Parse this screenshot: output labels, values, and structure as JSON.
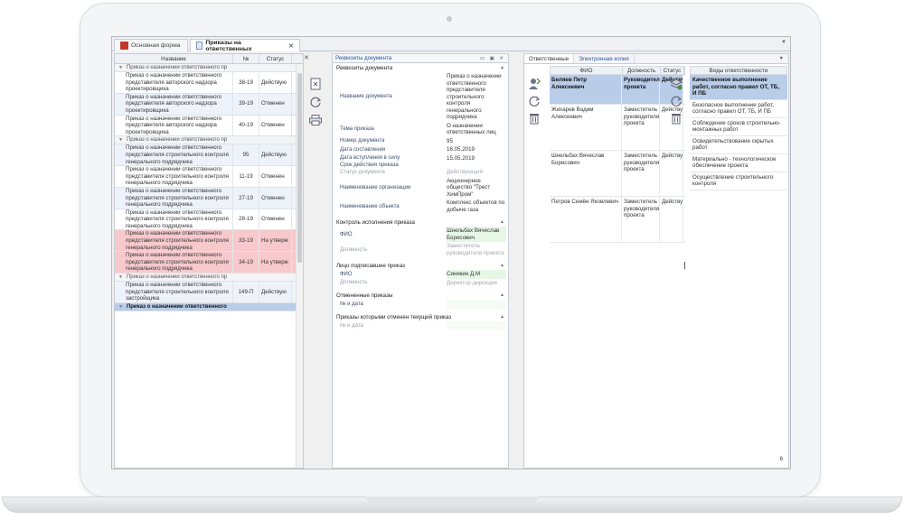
{
  "tabs": [
    {
      "label": "Основная форма"
    },
    {
      "label": "Приказы на ответственных"
    }
  ],
  "orders": {
    "columns": [
      "Название",
      "№",
      "Статус"
    ],
    "groups": [
      {
        "label": "Приказ о назначении ответственного пр",
        "rows": [
          {
            "name": "Приказ о назначении ответственного представителя авторского надзора проектировщика",
            "num": "38-19",
            "status": "Действую",
            "tone": "normal"
          },
          {
            "name": "Приказ о назначении ответственного представителя авторского надзора проектировщика",
            "num": "39-19",
            "status": "Отменен",
            "tone": "alt"
          },
          {
            "name": "Приказ о назначении ответственного представителя авторского надзора проектировщика",
            "num": "40-19",
            "status": "Отменен",
            "tone": "normal"
          }
        ]
      },
      {
        "label": "Приказ о назначении ответственного пр",
        "rows": [
          {
            "name": "Приказ о назначении ответственного представителя строительного контроля генерального подрядчика",
            "num": "95",
            "status": "Действую",
            "tone": "alt"
          },
          {
            "name": "Приказ о назначении ответственного представителя строительного контроля генерального подрядчика",
            "num": "11-19",
            "status": "Отменен",
            "tone": "normal"
          },
          {
            "name": "Приказ о назначении ответственного представителя строительного контроля генерального подрядчика",
            "num": "27-19",
            "status": "Отменен",
            "tone": "alt"
          },
          {
            "name": "Приказ о назначении ответственного представителя строительного контроля генерального подрядчика",
            "num": "28-19",
            "status": "Отменен",
            "tone": "normal"
          },
          {
            "name": "Приказ о назначении ответственного представителя строительного контроля генерального подрядчика",
            "num": "33-19",
            "status": "На утверж",
            "tone": "red"
          },
          {
            "name": "Приказ о назначении ответственного представителя строительного контроля генерального подрядчика",
            "num": "34-19",
            "status": "На утверж",
            "tone": "red"
          }
        ]
      },
      {
        "label": "Приказ о назначении ответственного пр",
        "rows": [
          {
            "name": "Приказ о назначении ответственного представителя строительного контроля застройщика",
            "num": "149-П",
            "status": "Действую",
            "tone": "alt"
          }
        ]
      }
    ],
    "selected_group": "Приказ о назначении ответственного"
  },
  "details": {
    "title": "Реквизиты документа",
    "sections": [
      {
        "title": "Реквизиты документа",
        "fields": [
          {
            "label": "Название документа",
            "value": "Приказ о назначении ответственного представителя строительного контроля генерального подрядчика",
            "dim": false,
            "style": ""
          },
          {
            "label": "Тема приказа",
            "value": "О назначении ответственных лиц",
            "dim": false,
            "style": ""
          },
          {
            "label": "Номер документа",
            "value": "95",
            "dim": false,
            "style": ""
          },
          {
            "label": "Дата составления",
            "value": "16.05.2019",
            "dim": false,
            "style": ""
          },
          {
            "label": "Дата вступления в силу",
            "value": "15.05.2019",
            "dim": false,
            "style": ""
          },
          {
            "label": "Срок действия приказа",
            "value": "",
            "dim": false,
            "style": ""
          },
          {
            "label": "Статус документа",
            "value": "Действующий",
            "dim": true,
            "style": ""
          },
          {
            "label": "Наименование организации",
            "value": "Акционерное общество \"Трест ХимПром\"",
            "dim": false,
            "style": ""
          },
          {
            "label": "Наименование объекта",
            "value": "Комплекс объектов по добыче газа",
            "dim": false,
            "style": ""
          }
        ]
      },
      {
        "title": "Контроль исполнения приказа",
        "fields": [
          {
            "label": "ФИО",
            "value": "Шнельбах Вячеслав Борисович",
            "dim": false,
            "style": "green"
          },
          {
            "label": "Должность",
            "value": "Заместитель руководителя проекта",
            "dim": true,
            "style": ""
          }
        ]
      },
      {
        "title": "Лицо подписавшее приказ",
        "fields": [
          {
            "label": "ФИО",
            "value": "Синякин Д.М",
            "dim": false,
            "style": "green"
          },
          {
            "label": "Должность",
            "value": "Директор дирекции",
            "dim": true,
            "style": ""
          }
        ]
      },
      {
        "title": "Отмененные приказы",
        "fields": [
          {
            "label": "№ и дата",
            "value": "",
            "dim": false,
            "style": "empty"
          }
        ]
      },
      {
        "title": "Приказы которыми отменен текущий приказ",
        "fields": [
          {
            "label": "№ и дата",
            "value": "",
            "dim": true,
            "style": "empty"
          }
        ]
      }
    ]
  },
  "responsible": {
    "tabs": [
      "Ответственные",
      "Электронная копия"
    ],
    "columns": [
      "ФИО",
      "Должность",
      "Статус"
    ],
    "types_column": "Виды ответственности",
    "people": [
      {
        "fio": "Беляев Петр Алексеевич",
        "position": "Руководитель проекта",
        "status": "Действую",
        "selected": true
      },
      {
        "fio": "Жихарев Вадим Алексеевич",
        "position": "Заместитель руководителя проекта",
        "status": "Действую",
        "selected": false
      },
      {
        "fio": "Шнельбах Вячеслав Борисович",
        "position": "Заместитель руководителя проекта",
        "status": "Действую",
        "selected": false
      },
      {
        "fio": "Петров Семён Яковлевич",
        "position": "Заместитель руководителя проекта",
        "status": "Действую",
        "selected": false
      }
    ],
    "types": [
      {
        "label": "Качественное выполнение работ, согласно правил ОТ, ТБ, И ПБ",
        "selected": true
      },
      {
        "label": "Безопасное выполнение работ, согласно правил ОТ, ТБ, И ПБ",
        "selected": false
      },
      {
        "label": "Соблюдение сроков строительно-монтажных работ",
        "selected": false
      },
      {
        "label": "Освидетельствование скрытых работ",
        "selected": false
      },
      {
        "label": "Материально - технологическое обеспечение проекта",
        "selected": false
      },
      {
        "label": "Осуществление строительного контроля",
        "selected": false
      }
    ],
    "count": "6"
  }
}
